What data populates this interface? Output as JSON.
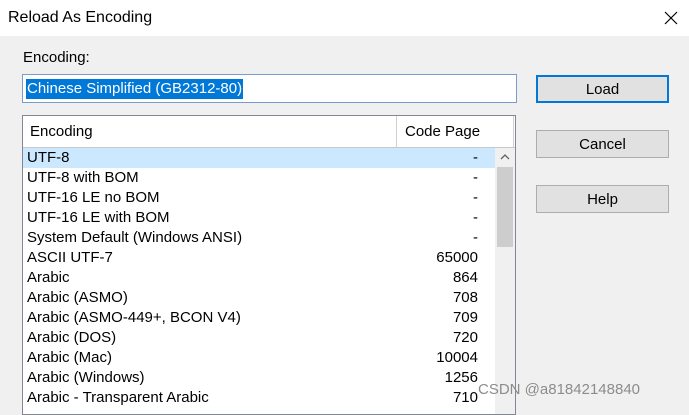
{
  "window": {
    "title": "Reload As Encoding",
    "close_icon": "close-icon"
  },
  "encoding": {
    "label": "Encoding:",
    "value": "Chinese Simplified (GB2312-80)"
  },
  "buttons": {
    "load": "Load",
    "cancel": "Cancel",
    "help": "Help"
  },
  "list": {
    "headers": {
      "encoding": "Encoding",
      "code_page": "Code Page"
    },
    "rows": [
      {
        "name": "UTF-8",
        "code_page": "-",
        "selected": true
      },
      {
        "name": "UTF-8 with BOM",
        "code_page": "-"
      },
      {
        "name": "UTF-16 LE no BOM",
        "code_page": "-"
      },
      {
        "name": "UTF-16 LE with BOM",
        "code_page": "-"
      },
      {
        "name": "System Default (Windows ANSI)",
        "code_page": "-"
      },
      {
        "name": "ASCII UTF-7",
        "code_page": "65000"
      },
      {
        "name": "Arabic",
        "code_page": "864"
      },
      {
        "name": "Arabic (ASMO)",
        "code_page": "708"
      },
      {
        "name": "Arabic (ASMO-449+, BCON V4)",
        "code_page": "709"
      },
      {
        "name": "Arabic (DOS)",
        "code_page": "720"
      },
      {
        "name": "Arabic (Mac)",
        "code_page": "10004"
      },
      {
        "name": "Arabic (Windows)",
        "code_page": "1256"
      },
      {
        "name": "Arabic - Transparent Arabic",
        "code_page": "710"
      }
    ]
  },
  "watermark": "CSDN @a81842148840",
  "colors": {
    "selection": "#0078d7",
    "row_selected": "#cce8ff"
  }
}
